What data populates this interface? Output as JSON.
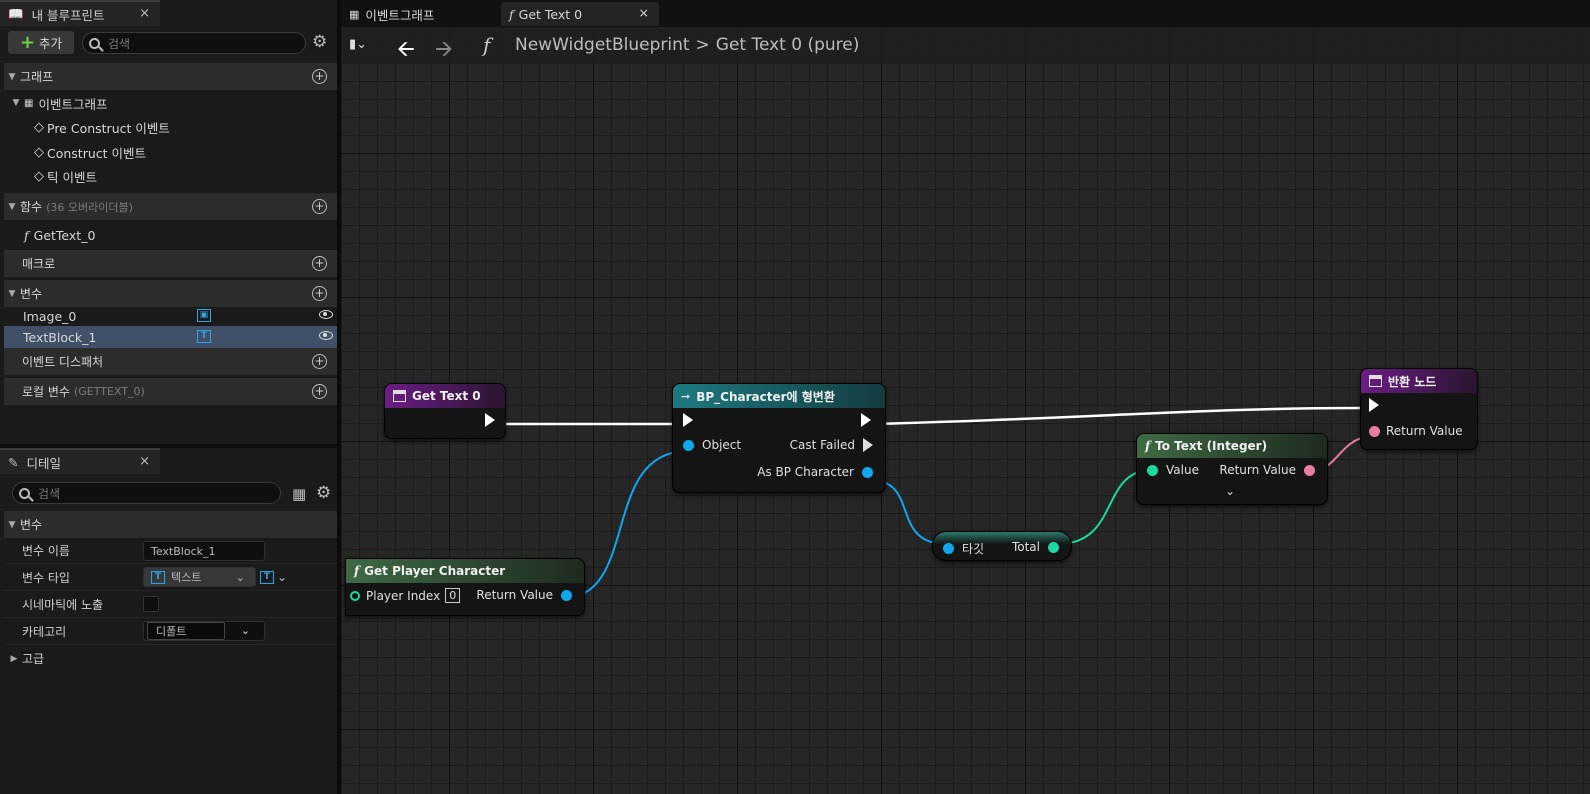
{
  "left_tabs": {
    "blueprint_tab": "내 블루프린트",
    "close": "×"
  },
  "toolbar_left": {
    "add_label": "추가",
    "search_placeholder": "검색"
  },
  "sections": {
    "graphs": "그래프",
    "eventgraph": "이벤트그래프",
    "events": [
      "Pre Construct 이벤트",
      "Construct 이벤트",
      "틱 이벤트"
    ],
    "functions": "함수",
    "functions_sub": "(36 오버라이더블)",
    "function_items": [
      "GetText_0"
    ],
    "macros": "매크로",
    "variables": "변수",
    "variable_items": [
      "Image_0",
      "TextBlock_1"
    ],
    "dispatchers": "이벤트 디스패처",
    "local_vars": "로컬 변수",
    "local_vars_sub": "(GETTEXT_0)"
  },
  "details": {
    "tab": "디테일",
    "close": "×",
    "search_placeholder": "검색",
    "section": "변수",
    "rows": {
      "name_label": "변수 이름",
      "name_value": "TextBlock_1",
      "type_label": "변수 타입",
      "type_value": "텍스트",
      "cinematic_label": "시네마틱에 노출",
      "category_label": "카테고리",
      "category_value": "디폴트"
    },
    "advanced": "고급"
  },
  "graph_tabs": [
    "이벤트그래프",
    "Get Text 0"
  ],
  "breadcrumb": {
    "root": "NewWidgetBlueprint",
    "sep": ">",
    "current": "Get Text 0 (pure)"
  },
  "nodes": {
    "entry": "Get Text 0",
    "cast": {
      "title": "BP_Character에 형변환",
      "object": "Object",
      "cast_failed": "Cast Failed",
      "as_bp": "As BP Character"
    },
    "get_player": {
      "title": "Get Player Character",
      "player_index": "Player Index",
      "index_value": "0",
      "return_value": "Return Value"
    },
    "get_total": {
      "target": "타깃",
      "total": "Total"
    },
    "to_text": {
      "title": "To Text (Integer)",
      "value": "Value",
      "return_value": "Return Value"
    },
    "return": {
      "title": "반환 노드",
      "return_value": "Return Value"
    }
  },
  "colors": {
    "accent_blue": "#2aa5e8",
    "object_pin": "#0fa7ee",
    "int_pin": "#1ed8a0",
    "text_pin": "#e87ea0",
    "function_header": "#3f6a44",
    "cast_header": "#1c7a80",
    "entry_header": "#6b1d84",
    "selection": "#3f5067"
  }
}
